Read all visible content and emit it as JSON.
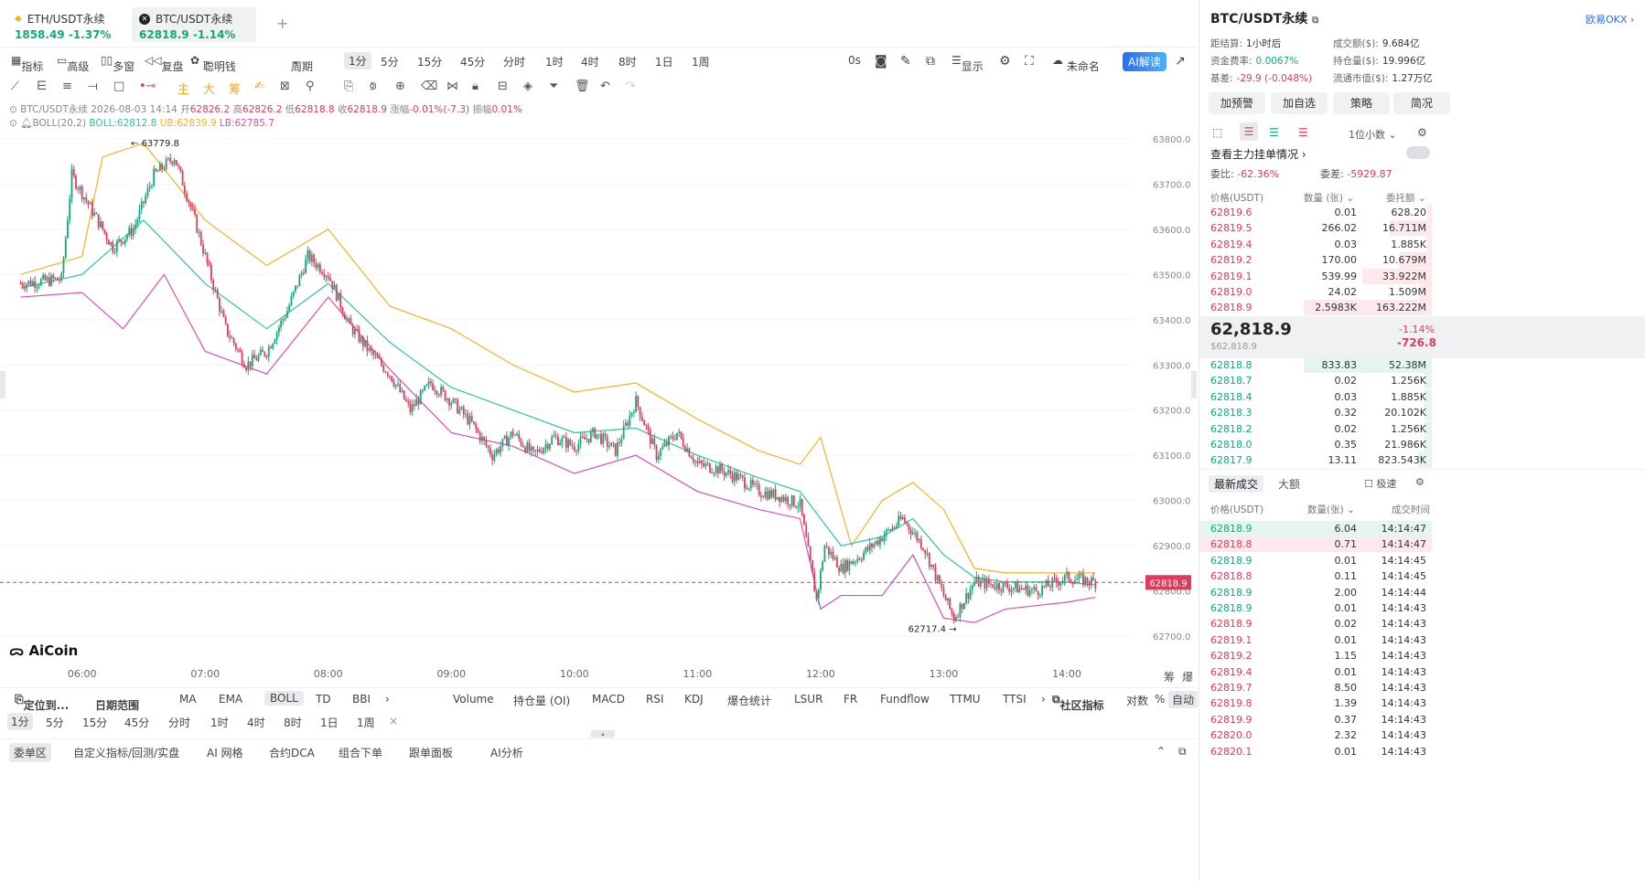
{
  "tabs": [
    {
      "name": "ETH/USDT永续",
      "price": "1858.49",
      "change": "-1.37%"
    },
    {
      "name": "BTC/USDT永续",
      "price": "62818.9",
      "change": "-1.14%"
    }
  ],
  "add_tab": "+",
  "toolbar": {
    "indicators": "指标",
    "advanced": "高级",
    "multi_window": "多窗",
    "replay": "复盘",
    "smart_money": "聪明钱",
    "period": "周期",
    "intervals": [
      "1分",
      "5分",
      "15分",
      "45分",
      "分时",
      "1时",
      "4时",
      "8时",
      "1日",
      "1周"
    ],
    "selected_interval": "1分",
    "countdown": "0s",
    "display": "显示",
    "unnamed": "未命名",
    "ai_explain": "AI解读"
  },
  "chart_info": {
    "symbol": "BTC/USDT永续",
    "datetime": "2026-08-03 14:14",
    "open_label": "开",
    "open": "62826.2",
    "high_label": "高",
    "high": "62826.2",
    "low_label": "低",
    "low": "62818.8",
    "close_label": "收",
    "close": "62818.9",
    "change_label": "涨幅",
    "change": "-0.01%(-7.3)",
    "amp_label": "振幅",
    "amp": "0.01%",
    "boll_name": "BOLL(20,2)",
    "boll": "BOLL:62812.8",
    "ub": "UB:62839.9",
    "lb": "LB:62785.7",
    "high_mark": "63779.8",
    "low_mark": "62717.4",
    "current_price_tag": "62818.9",
    "logo": "AiCoin",
    "bottom_right": [
      "筹",
      "爆"
    ]
  },
  "chart_data": {
    "type": "candlestick",
    "title": "BTC/USDT永续",
    "x_ticks": [
      "06:00",
      "07:00",
      "08:00",
      "09:00",
      "10:00",
      "11:00",
      "12:00",
      "13:00",
      "14:00"
    ],
    "y_ticks": [
      63800.0,
      63700.0,
      63600.0,
      63500.0,
      63400.0,
      63300.0,
      63200.0,
      63100.0,
      63000.0,
      62900.0,
      62800.0,
      62700.0
    ],
    "ylim": [
      62680,
      63820
    ],
    "current_price": 62818.9,
    "series": [
      {
        "name": "Price (approx close)",
        "x": [
          "05:30",
          "05:50",
          "05:55",
          "06:05",
          "06:15",
          "06:25",
          "06:35",
          "06:45",
          "06:55",
          "07:10",
          "07:20",
          "07:30",
          "07:40",
          "07:50",
          "08:00",
          "08:10",
          "08:20",
          "08:30",
          "08:40",
          "08:50",
          "09:00",
          "09:10",
          "09:20",
          "09:30",
          "09:40",
          "09:50",
          "10:00",
          "10:10",
          "10:20",
          "10:30",
          "10:40",
          "10:50",
          "11:00",
          "11:10",
          "11:20",
          "11:30",
          "11:40",
          "11:50",
          "11:58",
          "12:02",
          "12:10",
          "12:20",
          "12:30",
          "12:40",
          "12:50",
          "13:00",
          "13:05",
          "13:15",
          "13:30",
          "13:45",
          "14:00",
          "14:14"
        ],
        "values": [
          63480,
          63490,
          63720,
          63640,
          63560,
          63600,
          63720,
          63760,
          63620,
          63380,
          63300,
          63330,
          63420,
          63540,
          63500,
          63390,
          63330,
          63280,
          63200,
          63260,
          63220,
          63170,
          63100,
          63150,
          63100,
          63140,
          63120,
          63150,
          63110,
          63220,
          63100,
          63150,
          63080,
          63070,
          63050,
          63020,
          63010,
          62990,
          62780,
          62900,
          62850,
          62880,
          62920,
          62960,
          62900,
          62790,
          62740,
          62820,
          62810,
          62800,
          62830,
          62819
        ]
      },
      {
        "name": "UB",
        "x": [
          "05:30",
          "06:00",
          "06:10",
          "06:30",
          "07:00",
          "07:30",
          "08:00",
          "08:30",
          "09:00",
          "09:30",
          "10:00",
          "10:30",
          "11:00",
          "11:30",
          "11:50",
          "12:00",
          "12:15",
          "12:30",
          "12:45",
          "13:00",
          "13:15",
          "13:30",
          "14:00",
          "14:14"
        ],
        "values": [
          63500,
          63540,
          63760,
          63790,
          63620,
          63520,
          63600,
          63430,
          63380,
          63300,
          63240,
          63260,
          63180,
          63110,
          63080,
          63140,
          62900,
          63000,
          63040,
          62980,
          62850,
          62840,
          62840,
          62840
        ]
      },
      {
        "name": "BOLL",
        "x": [
          "05:30",
          "06:00",
          "06:30",
          "07:00",
          "07:30",
          "08:00",
          "08:30",
          "09:00",
          "09:30",
          "10:00",
          "10:30",
          "11:00",
          "11:30",
          "11:50",
          "12:10",
          "12:30",
          "12:45",
          "13:00",
          "13:15",
          "13:30",
          "14:00",
          "14:14"
        ],
        "values": [
          63470,
          63500,
          63620,
          63480,
          63380,
          63480,
          63350,
          63250,
          63200,
          63150,
          63160,
          63100,
          63050,
          63020,
          62900,
          62920,
          62960,
          62880,
          62830,
          62820,
          62820,
          62813
        ]
      },
      {
        "name": "LB",
        "x": [
          "05:30",
          "06:00",
          "06:20",
          "06:40",
          "07:00",
          "07:30",
          "08:00",
          "08:30",
          "09:00",
          "09:30",
          "10:00",
          "10:30",
          "11:00",
          "11:30",
          "11:50",
          "12:00",
          "12:10",
          "12:30",
          "12:45",
          "13:00",
          "13:15",
          "13:30",
          "14:00",
          "14:14"
        ],
        "values": [
          63450,
          63460,
          63380,
          63500,
          63330,
          63280,
          63450,
          63290,
          63150,
          63120,
          63060,
          63100,
          63020,
          62980,
          62960,
          62760,
          62790,
          62790,
          62880,
          62740,
          62730,
          62760,
          62775,
          62786
        ]
      }
    ]
  },
  "bottom_indicators": {
    "locate": "定位到...",
    "date_range": "日期范围",
    "main": [
      "MA",
      "EMA",
      "BOLL",
      "TD",
      "BBI"
    ],
    "sub": [
      "Volume",
      "持仓量 (OI)",
      "MACD",
      "RSI",
      "KDJ",
      "爆仓统计",
      "LSUR",
      "FR",
      "Fundflow",
      "TTMU",
      "TTSI"
    ],
    "community": "社区指标",
    "log": "对数",
    "percent": "%",
    "auto": "自动",
    "intervals": [
      "1分",
      "5分",
      "15分",
      "45分",
      "分时",
      "1时",
      "4时",
      "8时",
      "1日",
      "1周"
    ],
    "close": "×"
  },
  "bottom_tabs": [
    "委单区",
    "自定义指标/回测/实盘",
    "AI 网格",
    "合约DCA",
    "组合下单",
    "跟单面板",
    "AI分析"
  ],
  "side": {
    "title": "BTC/USDT永续",
    "exchange": "欧易OKX",
    "stats": [
      {
        "k": "距结算:",
        "v": "1小时后"
      },
      {
        "k": "成交额($):",
        "v": "9.684亿"
      },
      {
        "k": "资金费率:",
        "v": "0.0067%"
      },
      {
        "k": "持仓量($):",
        "v": "19.996亿"
      },
      {
        "k": "基差:",
        "v": "-29.9 (-0.048%)"
      },
      {
        "k": "流通市值($):",
        "v": "1.27万亿"
      }
    ],
    "buttons": [
      "加预警",
      "加自选",
      "策略",
      "简况"
    ],
    "precision": "1位小数",
    "main_orders": "查看主力挂单情况",
    "ratio_label": "委比:",
    "ratio": "-62.36%",
    "diff_label": "委差:",
    "diff": "-5929.87",
    "ob_headers": [
      "价格(USDT)",
      "数量 (张)",
      "委托额"
    ],
    "asks": [
      {
        "p": "62819.6",
        "q": "0.01",
        "a": "628.20",
        "w": 0.02
      },
      {
        "p": "62819.5",
        "q": "266.02",
        "a": "16.711M",
        "w": 0.18
      },
      {
        "p": "62819.4",
        "q": "0.03",
        "a": "1.885K",
        "w": 0.02
      },
      {
        "p": "62819.2",
        "q": "170.00",
        "a": "10.679M",
        "w": 0.14
      },
      {
        "p": "62819.1",
        "q": "539.99",
        "a": "33.922M",
        "w": 0.3
      },
      {
        "p": "62819.0",
        "q": "24.02",
        "a": "1.509M",
        "w": 0.05
      },
      {
        "p": "62818.9",
        "q": "2.5983K",
        "a": "163.222M",
        "w": 0.55
      }
    ],
    "last_price": "62,818.9",
    "last_usd": "$62,818.9",
    "last_pct": "-1.14%",
    "last_chg": "-726.8",
    "bids": [
      {
        "p": "62818.8",
        "q": "833.83",
        "a": "52.38M",
        "w": 0.55
      },
      {
        "p": "62818.7",
        "q": "0.02",
        "a": "1.256K",
        "w": 0.03
      },
      {
        "p": "62818.4",
        "q": "0.03",
        "a": "1.885K",
        "w": 0.03
      },
      {
        "p": "62818.3",
        "q": "0.32",
        "a": "20.102K",
        "w": 0.03
      },
      {
        "p": "62818.2",
        "q": "0.02",
        "a": "1.256K",
        "w": 0.03
      },
      {
        "p": "62818.0",
        "q": "0.35",
        "a": "21.986K",
        "w": 0.03
      },
      {
        "p": "62817.9",
        "q": "13.11",
        "a": "823.543K",
        "w": 0.06
      }
    ],
    "trade_tabs": [
      "最新成交",
      "大额"
    ],
    "fast": "极速",
    "tr_headers": [
      "价格(USDT)",
      "数量(张)",
      "成交时间"
    ],
    "trades": [
      {
        "p": "62818.9",
        "q": "6.04",
        "t": "14:14:47",
        "s": "b",
        "hl": true
      },
      {
        "p": "62818.8",
        "q": "0.71",
        "t": "14:14:47",
        "s": "s",
        "hl": true
      },
      {
        "p": "62818.9",
        "q": "0.01",
        "t": "14:14:45",
        "s": "b"
      },
      {
        "p": "62818.8",
        "q": "0.11",
        "t": "14:14:45",
        "s": "s"
      },
      {
        "p": "62818.9",
        "q": "2.00",
        "t": "14:14:44",
        "s": "b"
      },
      {
        "p": "62818.9",
        "q": "0.01",
        "t": "14:14:43",
        "s": "b"
      },
      {
        "p": "62818.9",
        "q": "0.02",
        "t": "14:14:43",
        "s": "s"
      },
      {
        "p": "62819.1",
        "q": "0.01",
        "t": "14:14:43",
        "s": "s"
      },
      {
        "p": "62819.2",
        "q": "1.15",
        "t": "14:14:43",
        "s": "s"
      },
      {
        "p": "62819.4",
        "q": "0.01",
        "t": "14:14:43",
        "s": "s"
      },
      {
        "p": "62819.7",
        "q": "8.50",
        "t": "14:14:43",
        "s": "s"
      },
      {
        "p": "62819.8",
        "q": "1.39",
        "t": "14:14:43",
        "s": "s"
      },
      {
        "p": "62819.9",
        "q": "0.37",
        "t": "14:14:43",
        "s": "s"
      },
      {
        "p": "62820.0",
        "q": "2.32",
        "t": "14:14:43",
        "s": "s"
      },
      {
        "p": "62820.1",
        "q": "0.01",
        "t": "14:14:43",
        "s": "s"
      }
    ]
  },
  "colors": {
    "up": "#13a77a",
    "down": "#e03c5a",
    "ub": "#f5b324",
    "boll": "#2ec4a4",
    "lb": "#d94fb8",
    "accent": "#2a6df4"
  }
}
